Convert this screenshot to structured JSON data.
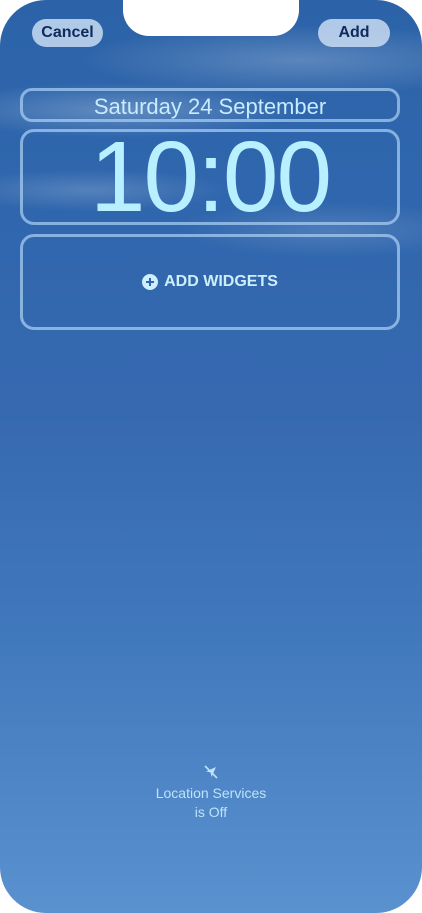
{
  "top_bar": {
    "cancel_label": "Cancel",
    "add_label": "Add"
  },
  "lock_screen": {
    "date": "Saturday 24 September",
    "time": "10:00",
    "add_widgets_label": "ADD WIDGETS"
  },
  "location_status": {
    "line1": "Location Services",
    "line2": "is Off",
    "icon": "location-off-icon"
  },
  "colors": {
    "accent_text": "#b8f0ff",
    "button_bg": "#d6e6f8",
    "button_text": "#0f2a5c",
    "wallpaper_top": "#2c63a8",
    "wallpaper_bottom": "#5a91cf"
  }
}
